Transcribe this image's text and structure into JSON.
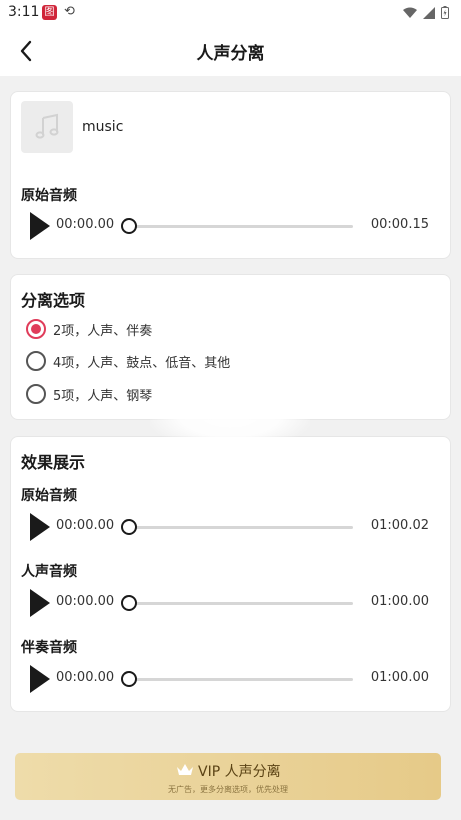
{
  "status_bar": {
    "time": "3:11",
    "badge": "图"
  },
  "header": {
    "title": "人声分离"
  },
  "file": {
    "name": "music"
  },
  "original": {
    "label": "原始音频",
    "current_time": "00:00.00",
    "duration": "00:00.15",
    "progress": 0
  },
  "separation": {
    "title": "分离选项",
    "options": [
      {
        "label": "2项，人声、伴奏",
        "selected": true
      },
      {
        "label": "4项，人声、鼓点、低音、其他",
        "selected": false
      },
      {
        "label": "5项，人声、钢琴",
        "selected": false
      }
    ]
  },
  "results": {
    "title": "效果展示",
    "tracks": [
      {
        "label": "原始音频",
        "current_time": "00:00.00",
        "duration": "01:00.02",
        "progress": 0
      },
      {
        "label": "人声音频",
        "current_time": "00:00.00",
        "duration": "01:00.00",
        "progress": 0
      },
      {
        "label": "伴奏音频",
        "current_time": "00:00.00",
        "duration": "01:00.00",
        "progress": 0
      }
    ]
  },
  "vip_button": {
    "label": "VIP 人声分离",
    "subtitle": "无广告，更多分离选项，优先处理"
  },
  "colors": {
    "accent": "#e03c5a",
    "vip_gradient_start": "#eedcaa",
    "vip_gradient_end": "#e6ca88"
  }
}
